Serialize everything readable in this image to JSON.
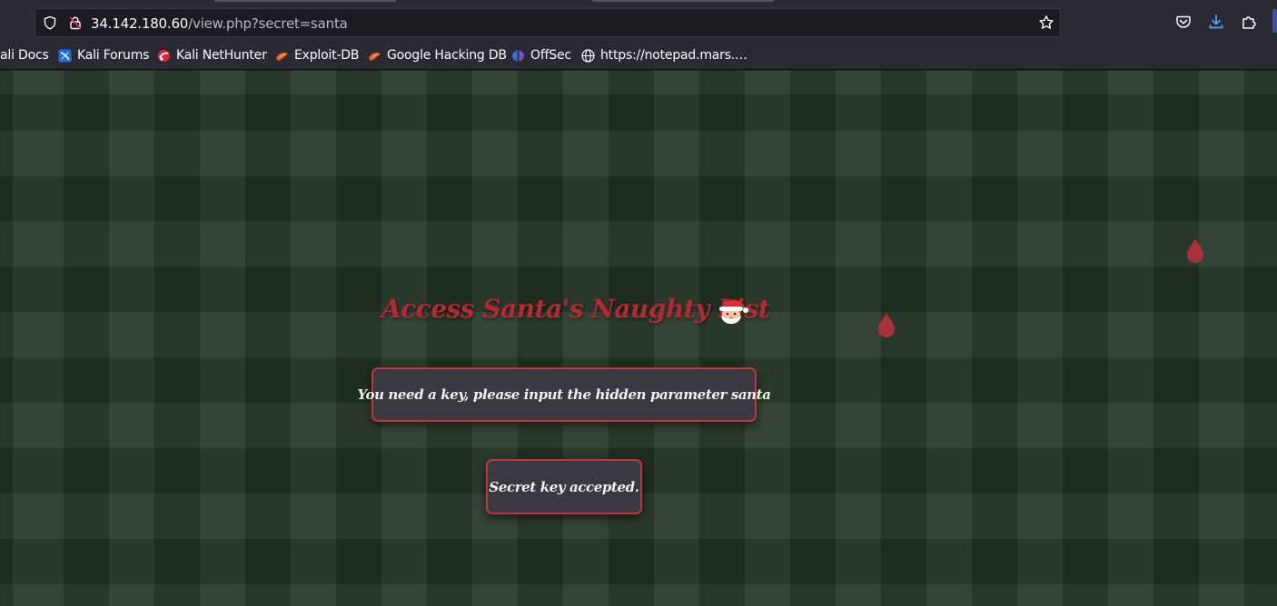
{
  "browser": {
    "url_host": "34.142.180.60",
    "url_path": "/view.php?secret=santa",
    "bookmarks": [
      {
        "label": "ali Docs",
        "icon": "docs-icon"
      },
      {
        "label": "Kali Forums",
        "icon": "kali-forums-icon"
      },
      {
        "label": "Kali NetHunter",
        "icon": "nethunter-icon"
      },
      {
        "label": "Exploit-DB",
        "icon": "exploit-db-icon"
      },
      {
        "label": "Google Hacking DB",
        "icon": "ghdb-icon"
      },
      {
        "label": "OffSec",
        "icon": "offsec-icon"
      },
      {
        "label": "https://notepad.mars.…",
        "icon": "globe-icon"
      }
    ]
  },
  "page": {
    "heading": "Access Santa's Naughty List",
    "heading_emoji": "santa-icon",
    "message_key_required": "You need a key, please input the hidden parameter santa",
    "message_key_accepted": "Secret key accepted.",
    "colors": {
      "accent_red": "#b32a33",
      "box_border": "#c0363d",
      "box_bg": "#3a3942",
      "page_bg": "#1f2d20"
    }
  }
}
